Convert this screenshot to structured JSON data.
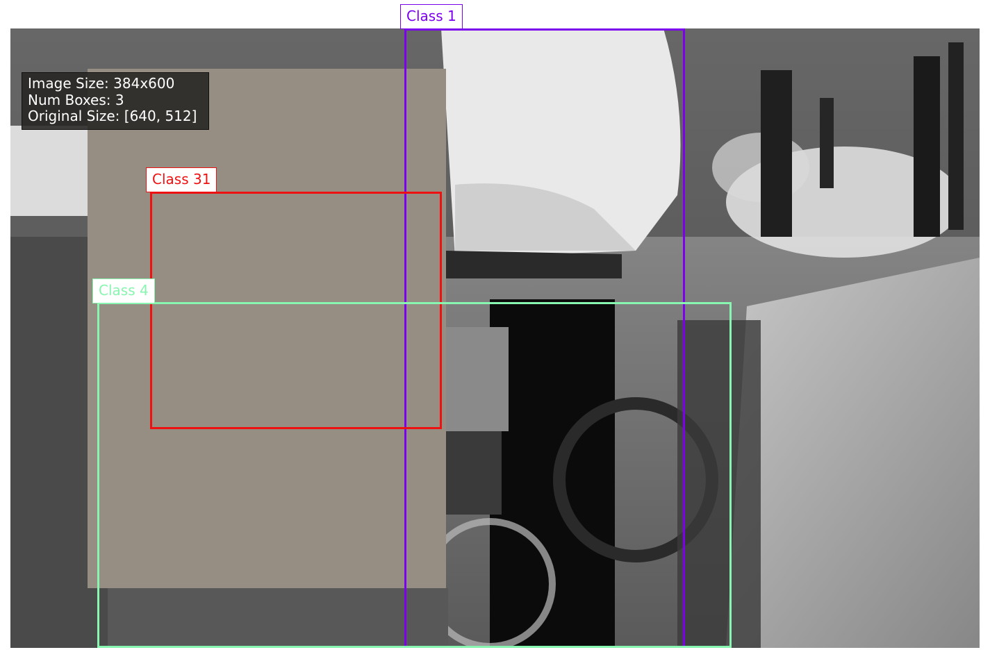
{
  "info": {
    "image_size": "Image Size: 384x600",
    "num_boxes": "Num Boxes: 3",
    "original_size": "Original Size: [640, 512]"
  },
  "boxes": [
    {
      "label": "Class 1",
      "color": "#7b00ee"
    },
    {
      "label": "Class 31",
      "color": "#ee1111"
    },
    {
      "label": "Class 4",
      "color": "#88f5b0"
    }
  ],
  "mask_color": "#968d83"
}
